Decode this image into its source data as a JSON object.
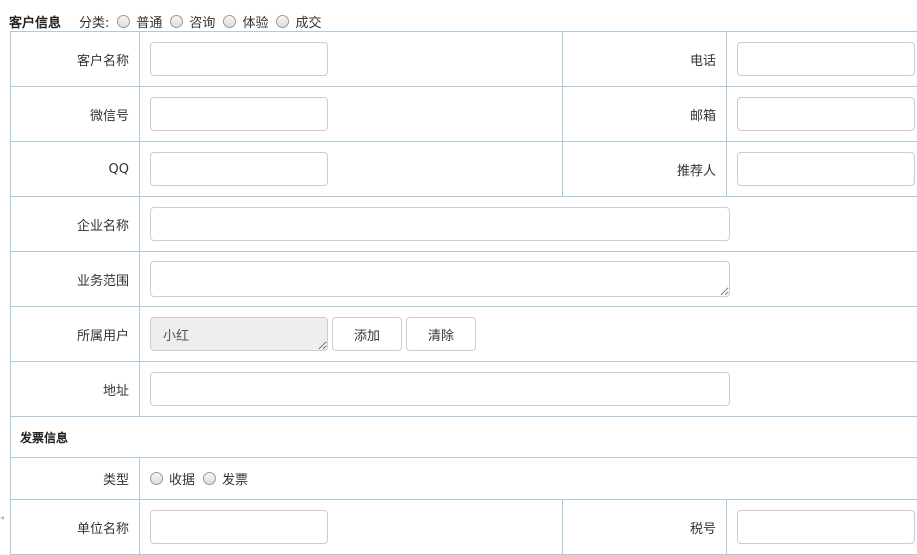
{
  "customer_section": {
    "title": "客户信息",
    "category_label": "分类:",
    "categories": [
      "普通",
      "咨询",
      "体验",
      "成交"
    ]
  },
  "fields": {
    "customer_name": {
      "label": "客户名称",
      "value": ""
    },
    "phone": {
      "label": "电话",
      "value": ""
    },
    "wechat": {
      "label": "微信号",
      "value": ""
    },
    "email": {
      "label": "邮箱",
      "value": ""
    },
    "qq": {
      "label": "QQ",
      "value": ""
    },
    "referrer": {
      "label": "推荐人",
      "value": ""
    },
    "company_name": {
      "label": "企业名称",
      "value": ""
    },
    "business_scope": {
      "label": "业务范围",
      "value": ""
    },
    "owner_user": {
      "label": "所属用户",
      "value": "小红",
      "add_label": "添加",
      "clear_label": "清除"
    },
    "address": {
      "label": "地址",
      "value": ""
    }
  },
  "invoice_section": {
    "title": "发票信息",
    "type_label": "类型",
    "types": [
      "收据",
      "发票"
    ],
    "unit_name": {
      "label": "单位名称",
      "value": ""
    },
    "tax_number": {
      "label": "税号",
      "value": ""
    }
  },
  "colors": {
    "table_border": "#aacbe0",
    "input_border": "#cccccc",
    "readonly_bg": "#eeeeee"
  }
}
